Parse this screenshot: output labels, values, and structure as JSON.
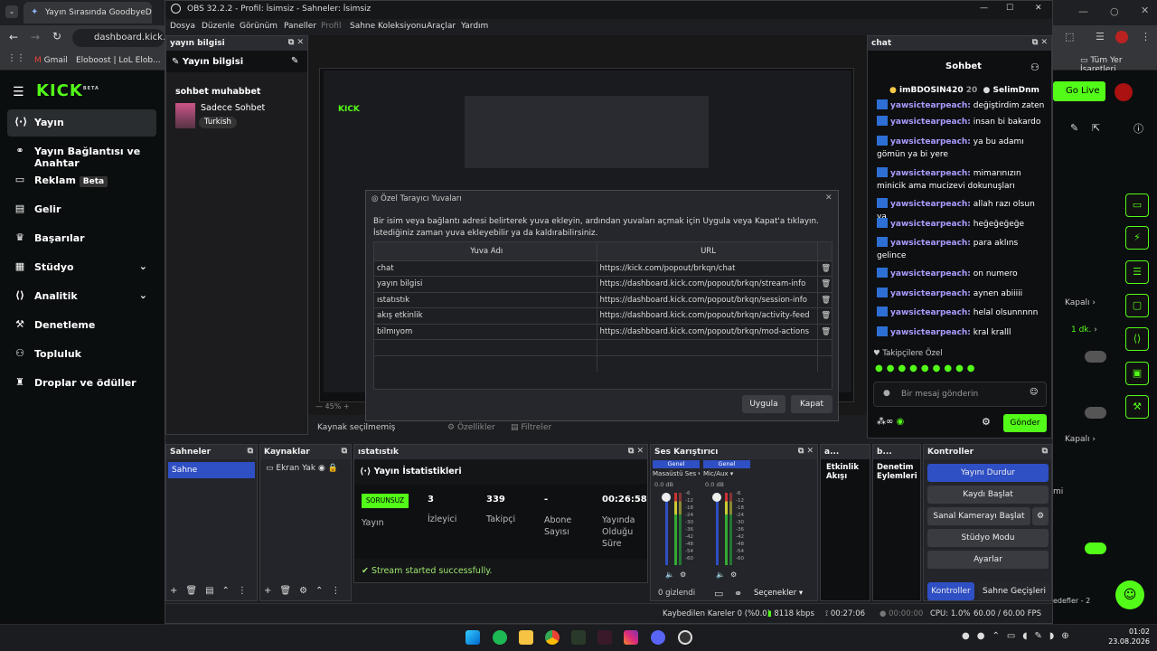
{
  "browser": {
    "tab_title": "Yayın Sırasında GoodbyeDPI Sc",
    "address": "dashboard.kick.com",
    "bookmarks": [
      "Gmail",
      "Eloboost | LoL Elob..."
    ],
    "all_bookmarks": "Tüm Yer İşaretleri"
  },
  "kick": {
    "logo": "KICK",
    "logo_badge": "BETA",
    "nav": [
      {
        "label": "Yayın",
        "icon": "broadcast-icon"
      },
      {
        "label": "Yayın Bağlantısı ve Anahtar",
        "icon": "link-icon"
      },
      {
        "label": "Reklam",
        "icon": "ad-icon",
        "badge": "Beta"
      },
      {
        "label": "Gelir",
        "icon": "revenue-icon"
      },
      {
        "label": "Başarılar",
        "icon": "trophy-icon"
      },
      {
        "label": "Stüdyo",
        "icon": "studio-icon"
      },
      {
        "label": "Analitik",
        "icon": "analytics-icon"
      },
      {
        "label": "Denetleme",
        "icon": "moderation-icon"
      },
      {
        "label": "Topluluk",
        "icon": "community-icon"
      },
      {
        "label": "Droplar ve ödüller",
        "icon": "drops-icon"
      }
    ],
    "go_live": "Go Live",
    "right_labels": [
      "Kapalı",
      "1 dk.",
      "Kapalı",
      "mi",
      "edefler - 2"
    ]
  },
  "obs": {
    "title": "OBS 32.2.2 - Profil: İsimsiz - Sahneler: İsimsiz",
    "menu": [
      "Dosya",
      "Düzenle",
      "Görünüm",
      "Paneller",
      "Profil",
      "Sahne Koleksiyonu",
      "Araçlar",
      "Yardım"
    ],
    "info_dock": {
      "header": "yayın bilgisi",
      "title": "Yayın bilgisi",
      "stream_title": "sohbet muhabbet",
      "category": "Sadece Sohbet",
      "tag": "Turkish"
    },
    "preview": {
      "no_source": "Kaynak seçilmemiş",
      "properties": "Özellikler",
      "filters": "Filtreler",
      "zoom": "45%"
    },
    "dialog": {
      "title": "Özel Tarayıcı Yuvaları",
      "description": "Bir isim veya bağlantı adresi belirterek yuva ekleyin, ardından yuvaları açmak için Uygula veya Kapat'a tıklayın. İstediğiniz zaman yuva ekleyebilir ya da kaldırabilirsiniz.",
      "col_name": "Yuva Adı",
      "col_url": "URL",
      "rows": [
        {
          "name": "chat",
          "url": "https://kick.com/popout/brkqn/chat"
        },
        {
          "name": "yayın bilgisi",
          "url": "https://dashboard.kick.com/popout/brkqn/stream-info"
        },
        {
          "name": "ıstatıstık",
          "url": "https://dashboard.kick.com/popout/brkqn/session-info"
        },
        {
          "name": "akış etkinlik",
          "url": "https://dashboard.kick.com/popout/brkqn/activity-feed"
        },
        {
          "name": "bilmıyom",
          "url": "https://dashboard.kick.com/popout/brkqn/mod-actions"
        }
      ],
      "apply": "Uygula",
      "close": "Kapat"
    },
    "chat": {
      "dock": "chat",
      "header": "Sohbet",
      "top_gifters": [
        {
          "name": "imBDOSIN420",
          "count": "20"
        },
        {
          "name": "SelimDnm",
          "count": ""
        }
      ],
      "messages": [
        {
          "user": "yawsictearpeach:",
          "text": " değiştirdim zaten"
        },
        {
          "user": "yawsictearpeach:",
          "text": " insan bi bakardo"
        },
        {
          "user": "yawsictearpeach:",
          "text": " ya bu adamı gömün ya bi yere"
        },
        {
          "user": "yawsictearpeach:",
          "text": " mimarınızın minicik ama mucizevi dokunuşları"
        },
        {
          "user": "yawsictearpeach:",
          "text": " allah razı olsun ya"
        },
        {
          "user": "yawsictearpeach:",
          "text": " heğeğeğeğe"
        },
        {
          "user": "yawsictearpeach:",
          "text": " para aklıns gelince"
        },
        {
          "user": "yawsictearpeach:",
          "text": " on numero"
        },
        {
          "user": "yawsictearpeach:",
          "text": " aynen abiiiii"
        },
        {
          "user": "yawsictearpeach:",
          "text": " helal olsunnnnn"
        },
        {
          "user": "yawsictearpeach:",
          "text": " kral kralll"
        }
      ],
      "followers_only": "Takipçilere Özel",
      "input_placeholder": "Bir mesaj gönderin",
      "send": "Gönder"
    },
    "scenes": {
      "header": "Sahneler",
      "items": [
        "Sahne"
      ]
    },
    "sources": {
      "header": "Kaynaklar",
      "items": [
        "Ekran Yak"
      ]
    },
    "stats": {
      "header": "ıstatıstık",
      "title": "Yayın İstatistikleri",
      "status": "SORUNSUZ",
      "status_label": "Yayın",
      "viewers": "3",
      "viewers_label": "İzleyici",
      "followers": "339",
      "followers_label": "Takipçi",
      "subs": "-",
      "subs_label": "Abone Sayısı",
      "duration": "00:26:58",
      "duration_label": "Yayında Olduğu Süre",
      "success": "Stream started successfully."
    },
    "mixer": {
      "header": "Ses Karıştırıcı",
      "channels": [
        {
          "tag": "Genel",
          "name": "Masaüstü Ses",
          "db": "0.0 dB"
        },
        {
          "tag": "Genel",
          "name": "Mic/Aux",
          "db": "0.0 dB"
        }
      ],
      "scale": [
        "-6",
        "-12",
        "-18",
        "-24",
        "-30",
        "-36",
        "-42",
        "-48",
        "-54",
        "-60"
      ],
      "hidden": "0 gizlendi",
      "options": "Seçenekler"
    },
    "activity": {
      "header": "a...",
      "title": "Etkinlik Akışı"
    },
    "mod": {
      "header": "b...",
      "title": "Denetim Eylemleri"
    },
    "controls": {
      "header": "Kontroller",
      "buttons": [
        "Yayını Durdur",
        "Kaydı Başlat",
        "Sanal Kamerayı Başlat",
        "Stüdyo Modu",
        "Ayarlar"
      ],
      "tabs": [
        "Kontroller",
        "Sahne Geçişleri"
      ]
    },
    "status_bar": {
      "dropped": "Kaybedilen Kareler 0 (%0.0)",
      "bitrate": "8118 kbps",
      "live_time": "00:27:06",
      "rec_time": "00:00:00",
      "cpu": "CPU: 1.0%",
      "fps": "60.00 / 60.00 FPS"
    }
  },
  "taskbar": {
    "time": "01:02",
    "date": "23.08.2026"
  },
  "colors": {
    "kick_green": "#53fc18",
    "obs_blue": "#2f4fc4",
    "chat_user": "#a99cff"
  }
}
